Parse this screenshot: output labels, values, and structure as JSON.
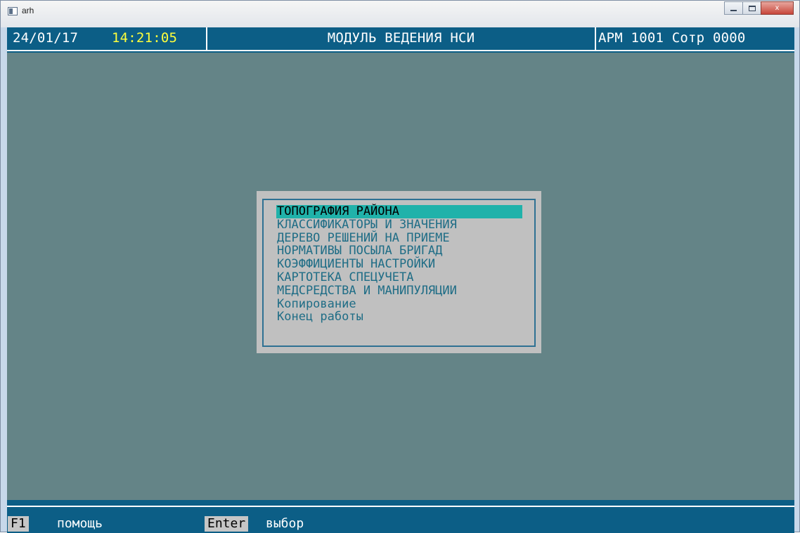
{
  "window": {
    "title": "arh",
    "controls": {
      "minimize": "minimize-icon",
      "maximize": "maximize-icon",
      "close": "x"
    }
  },
  "header": {
    "date": "24/01/17",
    "time": "14:21:05",
    "module_title": "МОДУЛЬ ВЕДЕНИЯ НСИ",
    "workstation": "АРМ 1001 Сотр 0000"
  },
  "menu": {
    "selected_index": 0,
    "items": [
      "ТОПОГРАФИЯ РАЙОНА",
      "КЛАССИФИКАТОРЫ И ЗНАЧЕНИЯ",
      "ДЕРЕВО РЕШЕНИЙ НА ПРИЕМЕ",
      "НОРМАТИВЫ ПОСЫЛА БРИГАД",
      "КОЭФФИЦИЕНТЫ НАСТРОЙКИ",
      "КАРТОТЕКА СПЕЦУЧЕТА",
      "МЕДСРЕДСТВА И МАНИПУЛЯЦИИ",
      "Копирование",
      "Конец работы"
    ]
  },
  "footer": {
    "keys": [
      {
        "key": "F1",
        "label": "помощь"
      },
      {
        "key": "Enter",
        "label": "выбор"
      }
    ]
  },
  "colors": {
    "console_bg": "#648487",
    "bar_bg": "#0c5e86",
    "time": "#ffff3c",
    "menu_bg": "#c0c0c0",
    "menu_text": "#1f6d86",
    "selection": "#20b2aa"
  }
}
